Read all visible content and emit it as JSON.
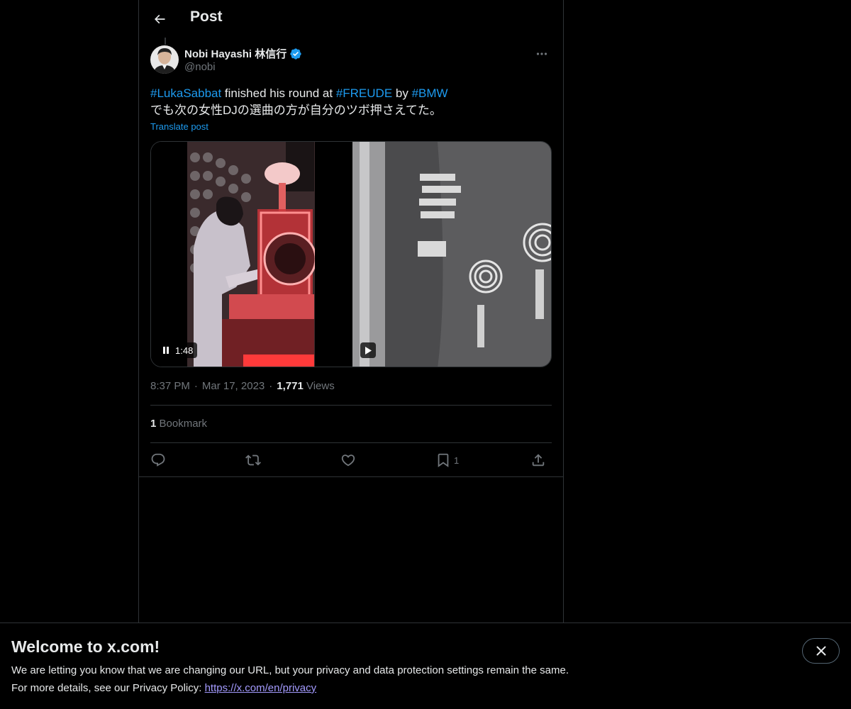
{
  "header": {
    "title": "Post"
  },
  "author": {
    "display_name": "Nobi Hayashi 林信行",
    "handle": "@nobi",
    "verified_color": "#1d9bf0"
  },
  "tweet": {
    "hashtag1": "#LukaSabbat",
    "text1": " finished his round at ",
    "hashtag2": "#FREUDE",
    "text2": " by ",
    "hashtag3": "#BMW",
    "line2": "でも次の女性DJの選曲の方が自分のツボ押さえてた。",
    "translate_label": "Translate post"
  },
  "media": {
    "video1_duration": "1:48",
    "video1_state": "playing",
    "video2_state": "paused"
  },
  "meta": {
    "time": "8:37 PM",
    "sep1": "·",
    "date": "Mar 17, 2023",
    "sep2": "·",
    "views_count": "1,771",
    "views_label": "Views"
  },
  "bookmarks": {
    "count": "1",
    "label": "Bookmark"
  },
  "actions": {
    "reply_icon": "reply-icon",
    "retweet_icon": "retweet-icon",
    "like_icon": "heart-icon",
    "bookmark_icon": "bookmark-icon",
    "bookmark_count": "1",
    "share_icon": "share-icon"
  },
  "banner": {
    "title": "Welcome to x.com!",
    "line1": "We are letting you know that we are changing our URL, but your privacy and data protection settings remain the same.",
    "line2_prefix": "For more details, see our Privacy Policy: ",
    "link": "https://x.com/en/privacy"
  },
  "colors": {
    "accent": "#1d9bf0",
    "background": "#000000",
    "text": "#e7e9ea",
    "muted": "#71767b",
    "border": "#2f3336",
    "link_visited": "#a49bff"
  }
}
